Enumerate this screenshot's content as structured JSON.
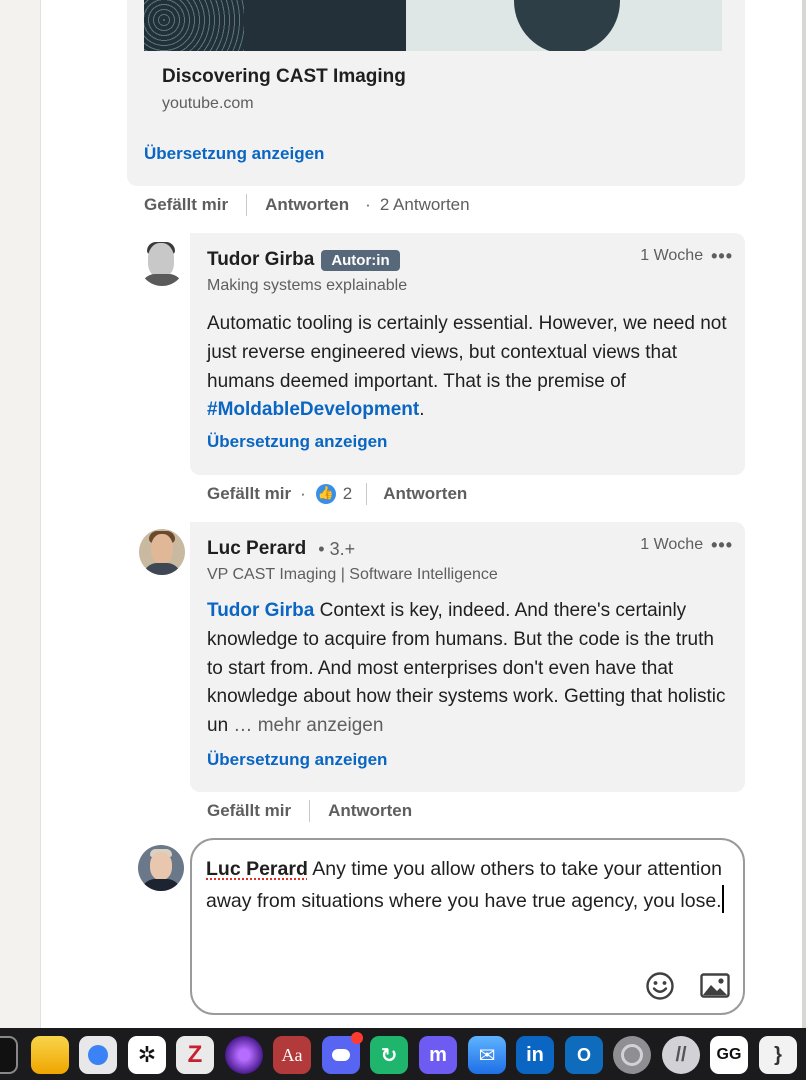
{
  "link_preview": {
    "title": "Discovering CAST Imaging",
    "domain": "youtube.com",
    "translate": "Übersetzung anzeigen"
  },
  "main_actions": {
    "like": "Gefällt mir",
    "reply": "Antworten",
    "reply_count": "2 Antworten"
  },
  "comments": [
    {
      "name": "Tudor Girba",
      "badge": "Autor:in",
      "headline": "Making systems explainable",
      "time": "1 Woche",
      "text_before": "Automatic tooling is certainly essential. However, we need not just reverse engineered views, but contextual views that humans deemed important. That is the premise of ",
      "hashtag": "#MoldableDevelopment",
      "text_after": ".",
      "translate": "Übersetzung anzeigen",
      "like": "Gefällt mir",
      "reaction_count": "2",
      "reply": "Antworten"
    },
    {
      "name": "Luc Perard",
      "degree": "• 3.+",
      "headline": "VP CAST Imaging | Software Intelligence",
      "time": "1 Woche",
      "mention": "Tudor Girba",
      "text": " Context is key, indeed. And there's certainly knowledge to acquire from humans. But the code is the truth to start from. And most enterprises don't even have that knowledge about how their systems work. Getting that holistic un",
      "see_more": "… mehr anzeigen",
      "translate": "Übersetzung anzeigen",
      "like": "Gefällt mir",
      "reply": "Antworten"
    }
  ],
  "composer": {
    "mention": "Luc Perard",
    "text": " Any time you allow others to take your attention away from situations where you have true agency, you lose."
  },
  "colors": {
    "link": "#0a66c2",
    "badge": "#56687a",
    "bubble": "#f2f2f2"
  },
  "dock": [
    "finder-icon",
    "notes-icon",
    "safari-icon",
    "chatgpt-icon",
    "zotero-icon",
    "tor-icon",
    "dictionary-icon",
    "discord-icon",
    "elytra-icon",
    "mastodon-icon",
    "mail-icon",
    "linkedin-icon",
    "outlook-icon",
    "settings-icon",
    "reeder-icon",
    "ggg-icon",
    "pdf-icon"
  ]
}
